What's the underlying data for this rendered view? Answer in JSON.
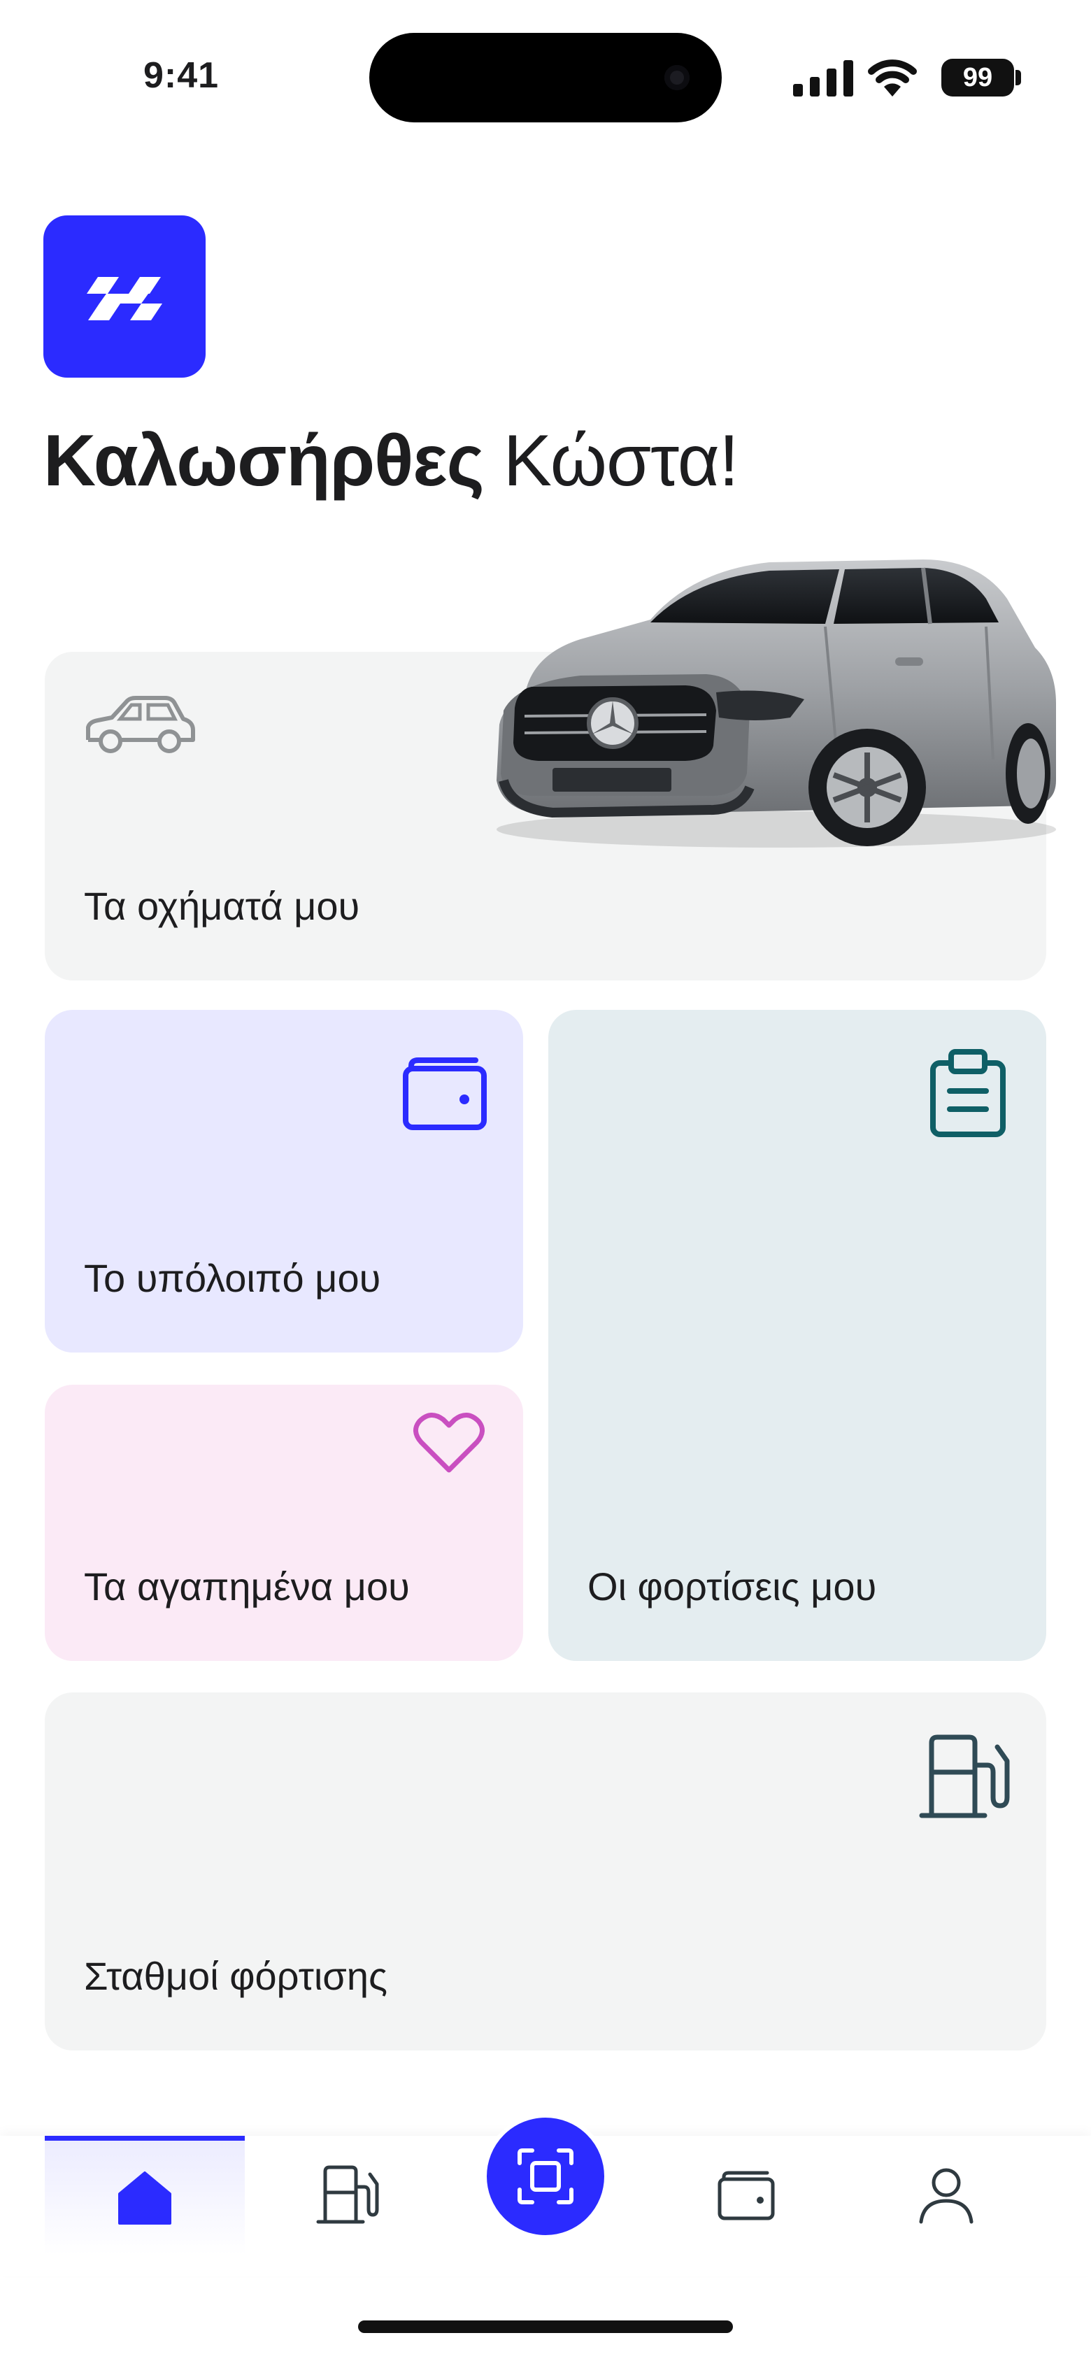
{
  "status_bar": {
    "time": "9:41",
    "battery": "99"
  },
  "header": {
    "greeting_bold": "Καλωσήρθες",
    "greeting_name": "Κώστα!",
    "logo_icon": "brand-logo-icon"
  },
  "cards": {
    "vehicles": {
      "label": "Τα οχήματά μου",
      "icon": "car-icon"
    },
    "balance": {
      "label": "Το υπόλοιπό μου",
      "icon": "wallet-icon"
    },
    "charges": {
      "label": "Οι φορτίσεις μου",
      "icon": "clipboard-icon"
    },
    "favorites": {
      "label": "Τα αγαπημένα μου",
      "icon": "heart-icon"
    },
    "stations": {
      "label": "Σταθμοί φόρτισης",
      "icon": "fuel-pump-icon"
    }
  },
  "bottom_nav": {
    "items": [
      {
        "name": "home",
        "icon": "home-icon",
        "active": true
      },
      {
        "name": "stations",
        "icon": "fuel-pump-icon",
        "active": false
      },
      {
        "name": "scan",
        "icon": "scan-icon",
        "active": false
      },
      {
        "name": "wallet",
        "icon": "wallet-icon",
        "active": false
      },
      {
        "name": "profile",
        "icon": "user-icon",
        "active": false
      }
    ]
  },
  "colors": {
    "brand": "#2b2bff",
    "card_gray": "#f3f4f4",
    "card_lavender": "#e8e8ff",
    "card_teal": "#e4edf0",
    "card_pink": "#fbeaf6",
    "teal_icon": "#0f5f66",
    "pink_icon": "#c94fc0"
  }
}
